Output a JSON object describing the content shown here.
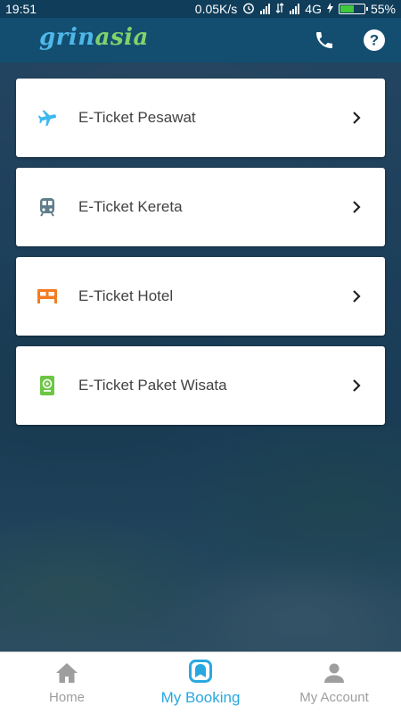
{
  "status_bar": {
    "time": "19:51",
    "network_speed": "0.05K/s",
    "network_type": "4G",
    "battery_percent": "55%"
  },
  "header": {
    "logo_part1": "grin",
    "logo_part2": "asia",
    "actions": [
      {
        "icon": "phone-icon"
      },
      {
        "icon": "help-icon"
      }
    ]
  },
  "tickets": [
    {
      "label": "E-Ticket Pesawat",
      "icon": "airplane-icon",
      "color": "#3db8ef"
    },
    {
      "label": "E-Ticket Kereta",
      "icon": "train-icon",
      "color": "#607d8b"
    },
    {
      "label": "E-Ticket Hotel",
      "icon": "bed-icon",
      "color": "#f47b20"
    },
    {
      "label": "E-Ticket Paket Wisata",
      "icon": "passport-icon",
      "color": "#6cc644"
    }
  ],
  "bottom_nav": {
    "items": [
      {
        "label": "Home",
        "icon": "home-icon",
        "active": false
      },
      {
        "label": "My Booking",
        "icon": "booking-icon",
        "active": true
      },
      {
        "label": "My Account",
        "icon": "account-icon",
        "active": false
      }
    ]
  },
  "colors": {
    "header_bg": "#134e70",
    "accent": "#29a8e0",
    "inactive_nav": "#9e9e9e"
  }
}
